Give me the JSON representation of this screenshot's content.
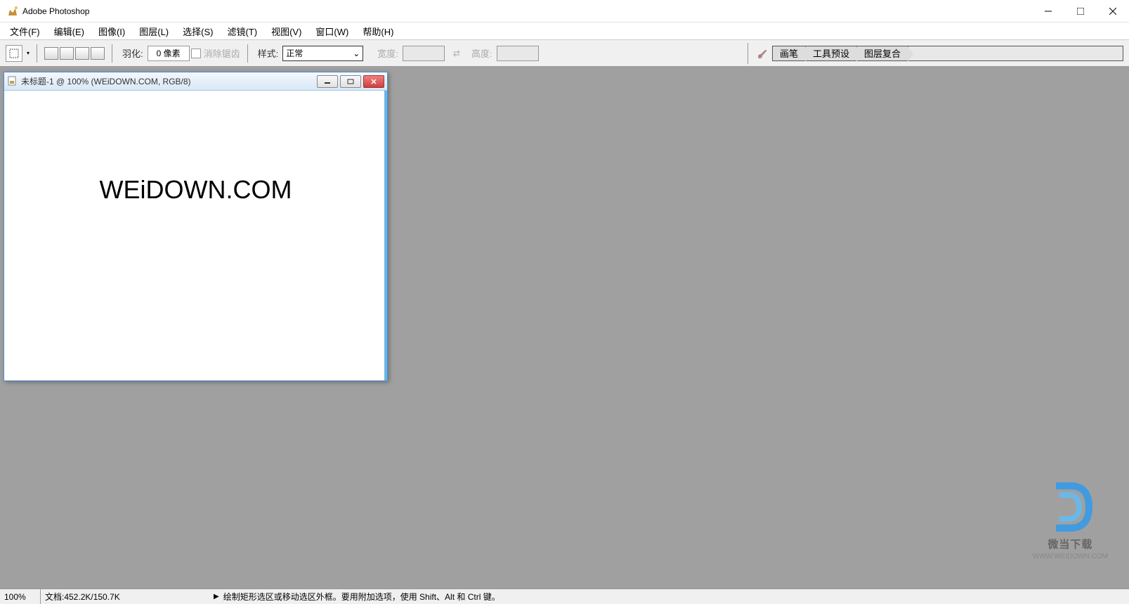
{
  "titlebar": {
    "app_name": "Adobe Photoshop"
  },
  "menubar": {
    "items": [
      "文件(F)",
      "编辑(E)",
      "图像(I)",
      "图层(L)",
      "选择(S)",
      "滤镜(T)",
      "视图(V)",
      "窗口(W)",
      "帮助(H)"
    ]
  },
  "optionsbar": {
    "feather_label": "羽化:",
    "feather_value": "0 像素",
    "antialias_label": "消除锯齿",
    "style_label": "样式:",
    "style_value": "正常",
    "width_label": "宽度:",
    "width_value": "",
    "height_label": "高度:",
    "height_value": "",
    "palette_tabs": [
      "画笔",
      "工具预设",
      "图层复合"
    ]
  },
  "document": {
    "title": "未标题-1 @ 100% (WEiDOWN.COM, RGB/8)",
    "canvas_text": "WEiDOWN.COM"
  },
  "watermark": {
    "logo": "D",
    "text": "微当下载",
    "url": "WWW.WEIDOWN.COM"
  },
  "statusbar": {
    "zoom": "100%",
    "doc_info": "文档:452.2K/150.7K",
    "hint": "绘制矩形选区或移动选区外框。要用附加选项，使用 Shift、Alt 和 Ctrl 键。"
  }
}
